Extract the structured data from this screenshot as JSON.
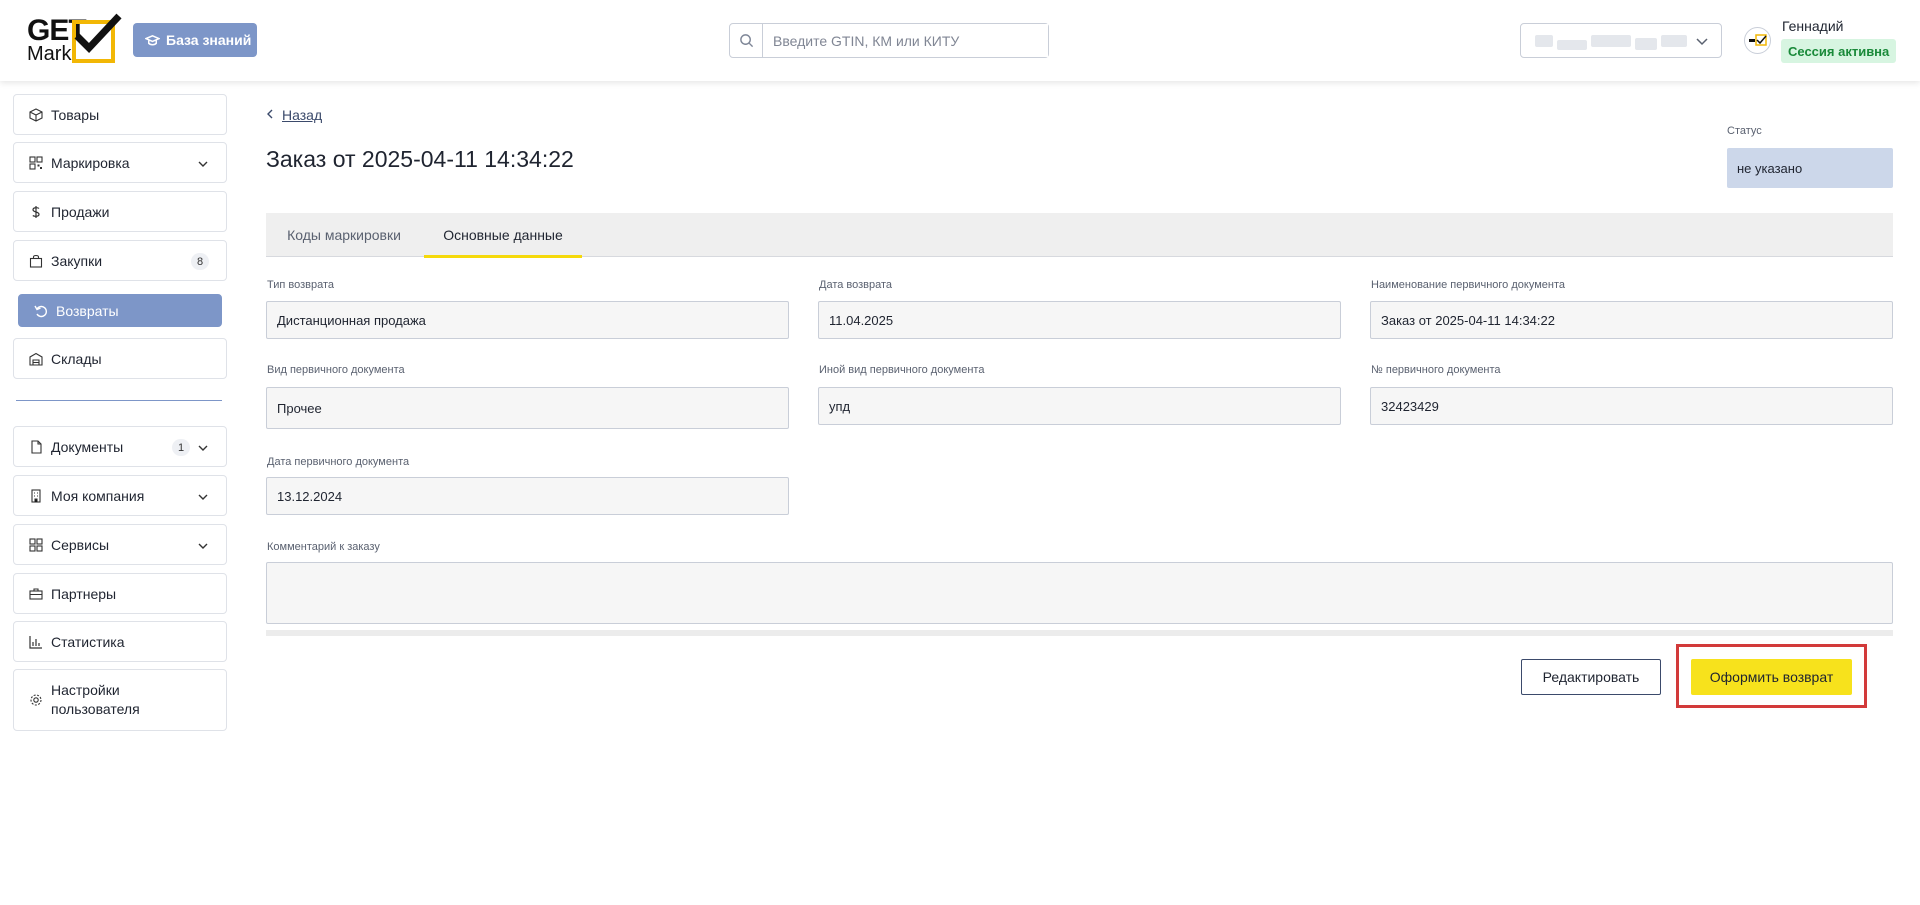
{
  "header": {
    "logo_top": "GET",
    "logo_bottom": "Mark",
    "knowledge_base_label": "База знаний",
    "search_placeholder": "Введите GTIN, КМ или КИТУ",
    "user_name": "Геннадий",
    "session_status": "Сессия активна",
    "colors": {
      "accent": "#7d96c8",
      "logo_yellow": "#f2b705",
      "session_green": "#1a8a3a"
    }
  },
  "sidebar": {
    "items": [
      {
        "label": "Товары",
        "icon": "box-icon"
      },
      {
        "label": "Маркировка",
        "icon": "qr-icon",
        "expandable": true
      },
      {
        "label": "Продажи",
        "icon": "dollar-icon"
      },
      {
        "label": "Закупки",
        "icon": "bag-icon",
        "count": "8"
      },
      {
        "label": "Возвраты",
        "icon": "return-icon",
        "active": true
      },
      {
        "label": "Склады",
        "icon": "warehouse-icon"
      },
      {
        "label": "Документы",
        "icon": "document-icon",
        "count": "1",
        "expandable": true
      },
      {
        "label": "Моя компания",
        "icon": "building-icon",
        "expandable": true
      },
      {
        "label": "Сервисы",
        "icon": "grid-icon",
        "expandable": true
      },
      {
        "label": "Партнеры",
        "icon": "partners-icon"
      },
      {
        "label": "Статистика",
        "icon": "chart-icon"
      },
      {
        "label": "Настройки пользователя",
        "icon": "gear-icon"
      }
    ]
  },
  "main": {
    "back_label": "Назад",
    "title": "Заказ от 2025-04-11 14:34:22",
    "status_label": "Статус",
    "status_value": "не указано",
    "tabs": [
      {
        "label": "Коды маркировки"
      },
      {
        "label": "Основные данные",
        "active": true
      }
    ],
    "fields": {
      "return_type": {
        "label": "Тип возврата",
        "value": "Дистанционная продажа"
      },
      "return_date": {
        "label": "Дата возврата",
        "value": "11.04.2025"
      },
      "primary_doc_name": {
        "label": "Наименование первичного документа",
        "value": "Заказ от 2025-04-11 14:34:22"
      },
      "primary_doc_type": {
        "label": "Вид первичного документа",
        "value": "Прочее"
      },
      "other_doc_type": {
        "label": "Иной вид первичного документа",
        "value": "упд"
      },
      "primary_doc_number": {
        "label": "№ первичного документа",
        "value": "32423429"
      },
      "primary_doc_date": {
        "label": "Дата первичного документа",
        "value": "13.12.2024"
      },
      "comment": {
        "label": "Комментарий к заказу",
        "value": ""
      }
    },
    "buttons": {
      "edit_label": "Редактировать",
      "submit_label": "Оформить возврат"
    }
  }
}
